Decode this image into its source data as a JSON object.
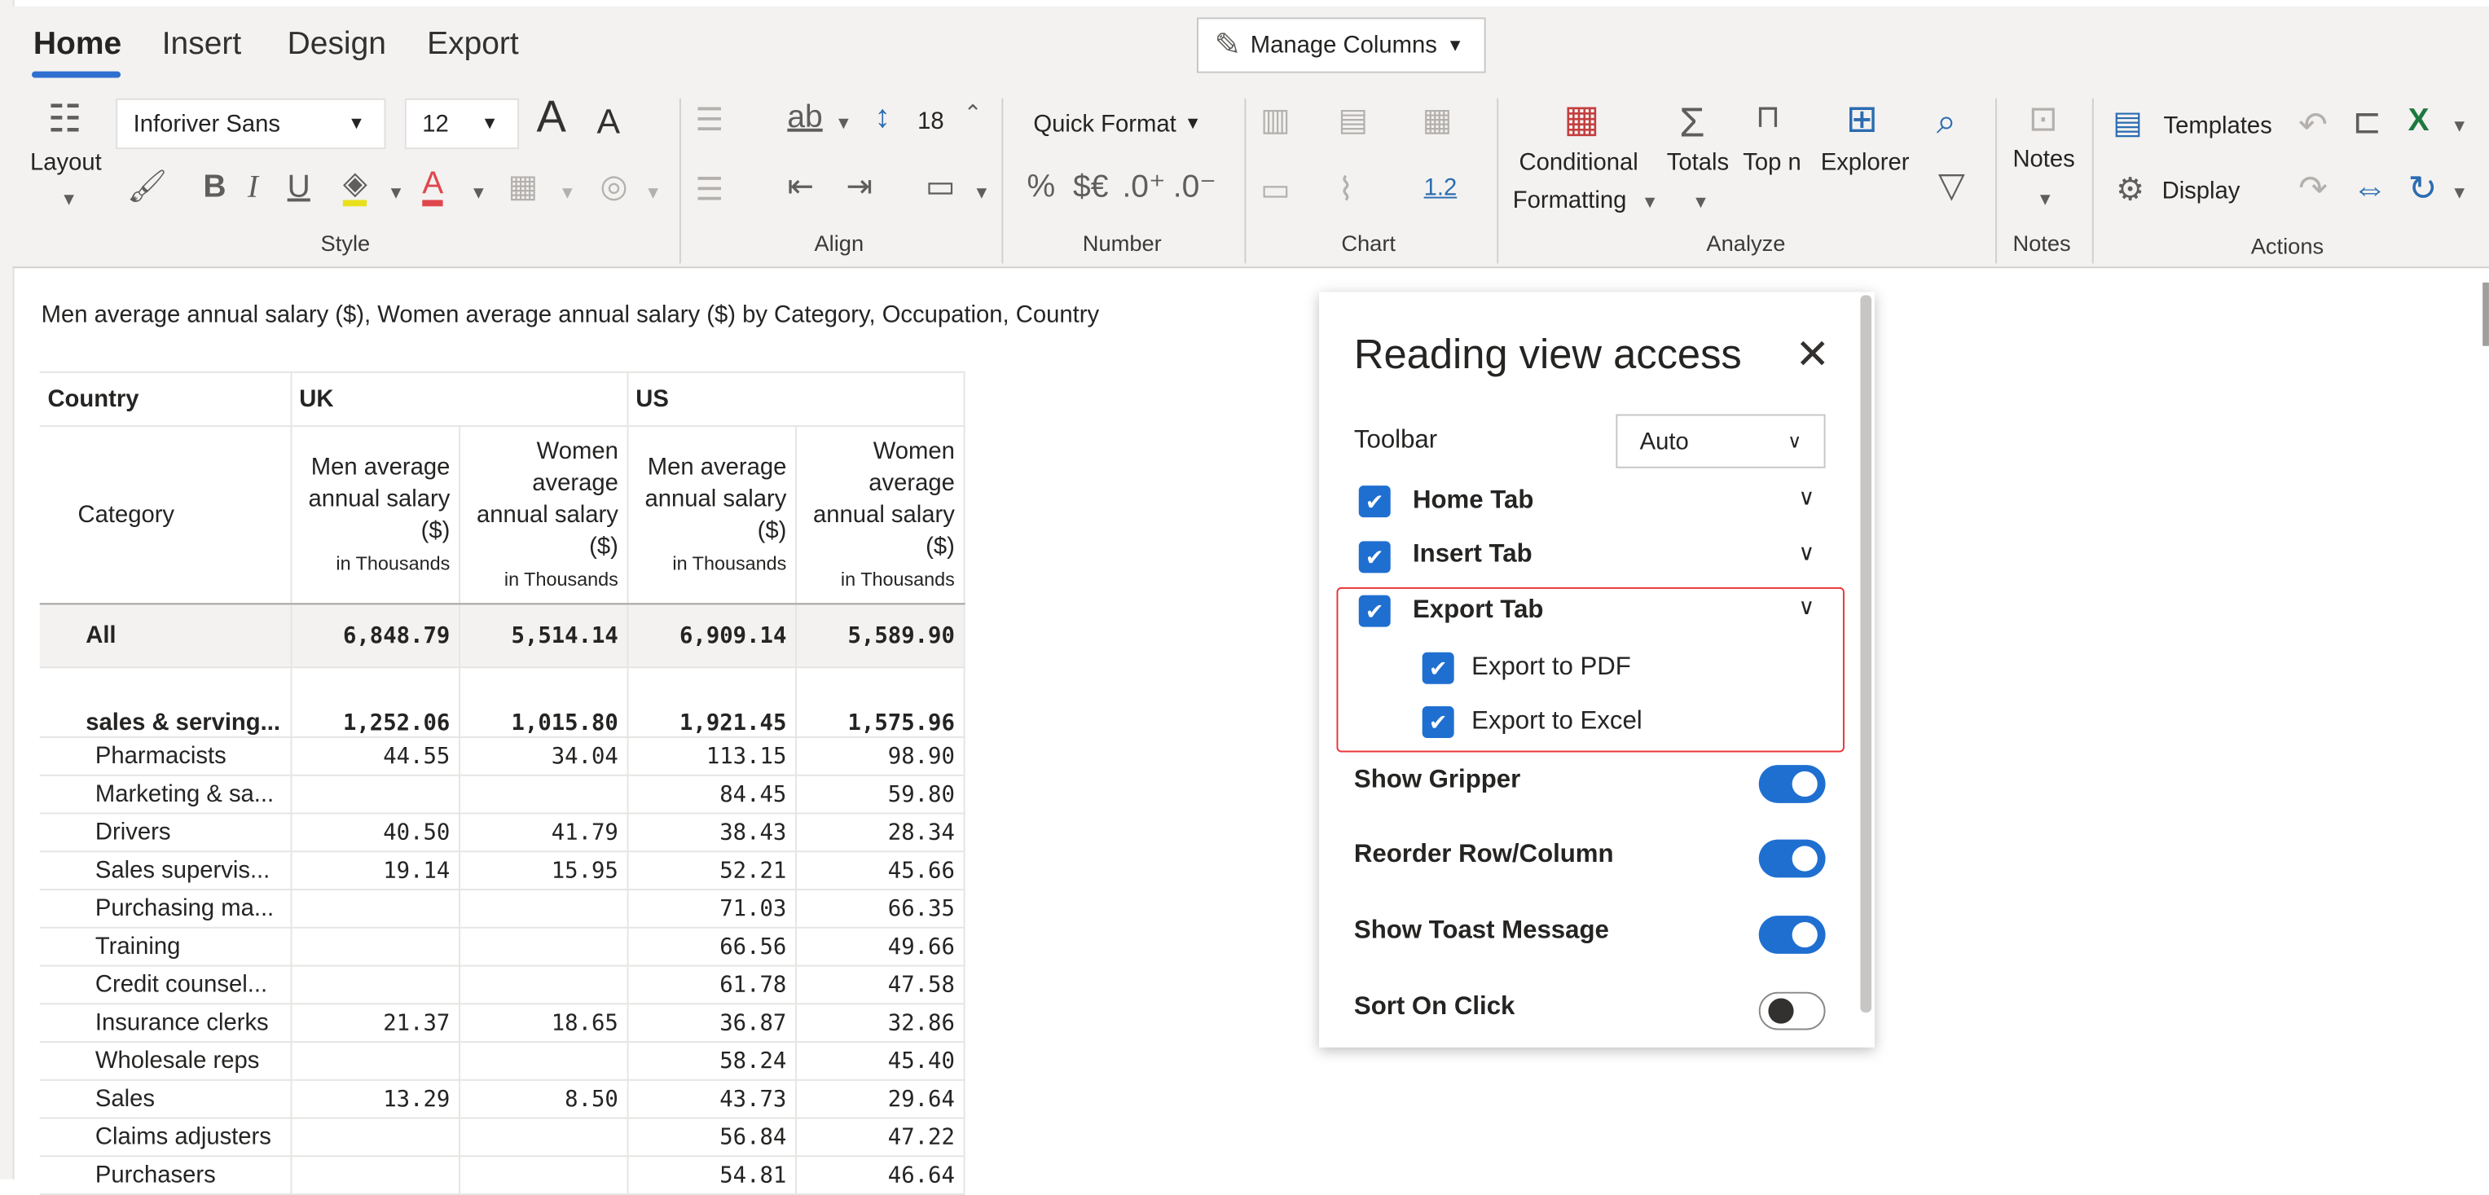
{
  "ribbon": {
    "tabs": [
      "Home",
      "Insert",
      "Design",
      "Export"
    ],
    "manage_columns": "Manage Columns",
    "layout_label": "Layout",
    "font_family": "Inforiver Sans",
    "font_size": "12",
    "spacing_value": "18",
    "quick_format": "Quick Format",
    "conditional_formatting_1": "Conditional",
    "conditional_formatting_2": "Formatting",
    "totals": "Totals",
    "top_n": "Top n",
    "explorer": "Explorer",
    "notes": "Notes",
    "templates": "Templates",
    "display": "Display",
    "number_decimal_label": "1.2",
    "groups": {
      "style": "Style",
      "align": "Align",
      "number": "Number",
      "chart": "Chart",
      "analyze": "Analyze",
      "notes": "Notes",
      "actions": "Actions"
    }
  },
  "report": {
    "subtitle": "Men average annual salary ($), Women average annual salary ($) by Category, Occupation, Country",
    "country_header": "Country",
    "category_header": "Category",
    "countries": [
      "UK",
      "US"
    ],
    "measures": [
      {
        "line1": "Men average",
        "line2": "annual salary",
        "line3": "($)",
        "line4": "",
        "unit": "in Thousands"
      },
      {
        "line1": "Women",
        "line2": "average",
        "line3": "annual salary",
        "line4": "($)",
        "unit": "in Thousands"
      },
      {
        "line1": "Men average",
        "line2": "annual salary",
        "line3": "($)",
        "line4": "",
        "unit": "in Thousands"
      },
      {
        "line1": "Women",
        "line2": "average",
        "line3": "annual salary",
        "line4": "($)",
        "unit": "in Thousands"
      }
    ],
    "rows": [
      {
        "label": "All",
        "values": [
          "6,848.79",
          "5,514.14",
          "6,909.14",
          "5,589.90"
        ]
      },
      {
        "label": "sales & serving...",
        "values": [
          "1,252.06",
          "1,015.80",
          "1,921.45",
          "1,575.96"
        ]
      },
      {
        "label": "Pharmacists",
        "values": [
          "44.55",
          "34.04",
          "113.15",
          "98.90"
        ]
      },
      {
        "label": "Marketing & sa...",
        "values": [
          "",
          "",
          "84.45",
          "59.80"
        ]
      },
      {
        "label": "Drivers",
        "values": [
          "40.50",
          "41.79",
          "38.43",
          "28.34"
        ]
      },
      {
        "label": "Sales supervis...",
        "values": [
          "19.14",
          "15.95",
          "52.21",
          "45.66"
        ]
      },
      {
        "label": "Purchasing ma...",
        "values": [
          "",
          "",
          "71.03",
          "66.35"
        ]
      },
      {
        "label": "Training",
        "values": [
          "",
          "",
          "66.56",
          "49.66"
        ]
      },
      {
        "label": "Credit counsel...",
        "values": [
          "",
          "",
          "61.78",
          "47.58"
        ]
      },
      {
        "label": "Insurance clerks",
        "values": [
          "21.37",
          "18.65",
          "36.87",
          "32.86"
        ]
      },
      {
        "label": "Wholesale reps",
        "values": [
          "",
          "",
          "58.24",
          "45.40"
        ]
      },
      {
        "label": "Sales",
        "values": [
          "13.29",
          "8.50",
          "43.73",
          "29.64"
        ]
      },
      {
        "label": "Claims adjusters",
        "values": [
          "",
          "",
          "56.84",
          "47.22"
        ]
      },
      {
        "label": "Purchasers",
        "values": [
          "",
          "",
          "54.81",
          "46.64"
        ]
      }
    ]
  },
  "panel": {
    "title": "Reading view access",
    "toolbar_label": "Toolbar",
    "toolbar_value": "Auto",
    "home_tab": "Home Tab",
    "insert_tab": "Insert Tab",
    "export_tab": "Export Tab",
    "export_pdf": "Export to PDF",
    "export_excel": "Export to Excel",
    "show_gripper": "Show Gripper",
    "reorder": "Reorder Row/Column",
    "show_toast": "Show Toast Message",
    "sort_on_click": "Sort On Click"
  },
  "colors": {
    "accent": "#1f6fd1",
    "highlight_border": "#e8373a",
    "excel_green": "#1d7a3e"
  }
}
